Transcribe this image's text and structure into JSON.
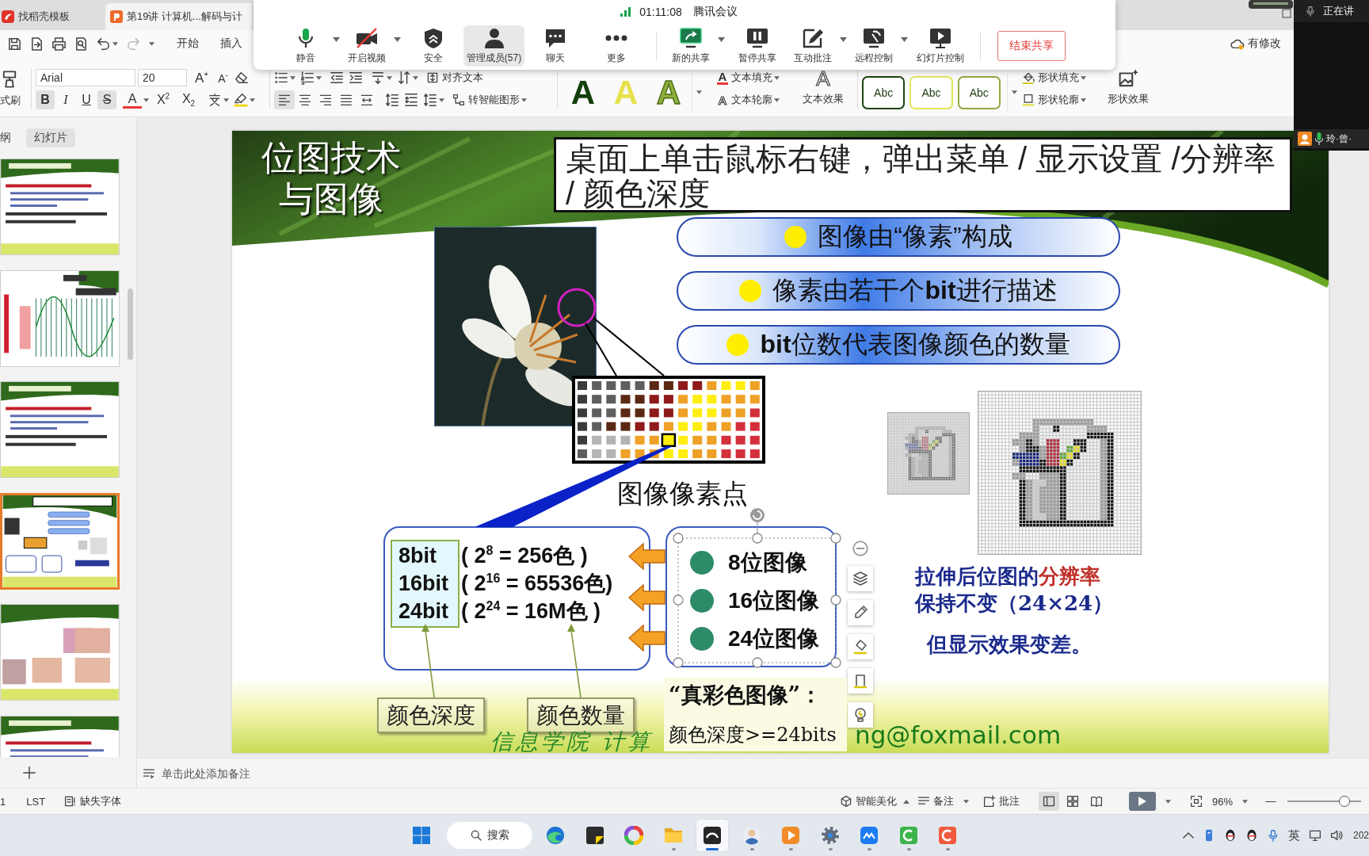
{
  "app_tabs": [
    {
      "kind": "docer",
      "label": "找稻壳模板",
      "selected": false
    },
    {
      "kind": "presentation",
      "label": "第19讲 计算机...解码与计",
      "selected": true
    }
  ],
  "meeting_toolbar": {
    "time": "01:11:08",
    "title": "腾讯会议",
    "buttons": [
      {
        "kind": "mic",
        "label": "静音",
        "dropdown": true,
        "selected": false
      },
      {
        "kind": "camera",
        "label": "开启视频",
        "dropdown": true,
        "selected": false
      },
      {
        "kind": "security",
        "label": "安全",
        "dropdown": false,
        "selected": false
      },
      {
        "kind": "members",
        "label": "管理成员(57)",
        "dropdown": false,
        "selected": true
      },
      {
        "kind": "chat",
        "label": "聊天",
        "dropdown": false,
        "selected": false
      },
      {
        "kind": "more",
        "label": "更多",
        "dropdown": false,
        "selected": false
      },
      {
        "kind": "share",
        "label": "新的共享",
        "dropdown": true,
        "selected": false
      },
      {
        "kind": "pause",
        "label": "暂停共享",
        "dropdown": false,
        "selected": false
      },
      {
        "kind": "annotate",
        "label": "互动批注",
        "dropdown": true,
        "selected": false
      },
      {
        "kind": "remote",
        "label": "远程控制",
        "dropdown": true,
        "selected": false
      },
      {
        "kind": "slideshow",
        "label": "幻灯片控制",
        "dropdown": false,
        "selected": false
      }
    ],
    "end_share": "结束共享"
  },
  "speaker": {
    "status": "正在讲",
    "name": "玲·曾·"
  },
  "quick_access": {
    "redo_disabled": true,
    "menus": [
      "开始",
      "插入"
    ],
    "save_status": "有修改"
  },
  "ribbon": {
    "format_painter": "式刷",
    "font_name": "Arial",
    "font_size": "20",
    "size_buttons": [
      {
        "kind": "grow",
        "label": "A$^{+}$"
      },
      {
        "kind": "shrink",
        "label": "A$^{-}$"
      }
    ],
    "format_buttons": [
      {
        "kind": "bold",
        "label": "B",
        "on": true
      },
      {
        "kind": "italic",
        "label": "I",
        "on": false
      },
      {
        "kind": "underline",
        "label": "U",
        "on": false
      },
      {
        "kind": "strike",
        "label": "S",
        "on": true
      },
      {
        "kind": "color",
        "label": "A",
        "on": false
      },
      {
        "kind": "sup",
        "label": "X$^{2}$",
        "on": false
      },
      {
        "kind": "sub",
        "label": "X$_{2}$",
        "on": false
      }
    ],
    "align_buttons": [
      {
        "kind": "left",
        "selected": true
      },
      {
        "kind": "center",
        "selected": false
      },
      {
        "kind": "right",
        "selected": false
      },
      {
        "kind": "justify",
        "selected": false
      },
      {
        "kind": "distributed",
        "selected": false
      }
    ],
    "align_text": "对齐文本",
    "smart_art": "转智能图形",
    "text_styles": [
      {
        "kind": "fill",
        "label": "A",
        "color": "#143f0c"
      },
      {
        "kind": "fill",
        "label": "A",
        "color": "#e6e24e"
      },
      {
        "kind": "outline",
        "label": "A",
        "color": "#8fb03c"
      }
    ],
    "text_fill": {
      "glyph": "A",
      "label": "文本填充"
    },
    "text_outline": {
      "glyph": "A",
      "label": "文本轮廓"
    },
    "text_effect": {
      "glyph": "A",
      "label": "文本效果"
    },
    "shape_styles": [
      {
        "label": "Abc",
        "color": "#1d4410"
      },
      {
        "label": "Abc",
        "color": "#e2e65a"
      },
      {
        "label": "Abc",
        "color": "#94a842"
      }
    ],
    "shape_fill": "形状填充",
    "shape_outline": "形状轮廓",
    "shape_effect": "形状效果"
  },
  "side_pane": {
    "tabs": [
      {
        "label": "纲",
        "selected": false
      },
      {
        "label": "幻灯片",
        "selected": true
      }
    ],
    "thumbnails": [
      {
        "kind": "text",
        "selected": false
      },
      {
        "kind": "waveform",
        "selected": false
      },
      {
        "kind": "text",
        "selected": false
      },
      {
        "kind": "current",
        "selected": true
      },
      {
        "kind": "photos",
        "selected": false
      },
      {
        "kind": "text",
        "selected": false
      }
    ]
  },
  "slide": {
    "title": "位图技术与图像",
    "instruction": "桌面上单击鼠标右键，弹出菜单 / 显示设置 /分辨率 / 颜色深度",
    "points": [
      "图像由“像素”构成",
      "像素由若干个**bit**进行描述",
      "**bit**位数代表图像颜色的数量"
    ],
    "pixel_label": "图像像素点",
    "bit_rows": [
      {
        "depth": "8bit",
        "count": "( 2$^{8}$ = 256色 )"
      },
      {
        "depth": "16bit",
        "count": "( 2$^{16}$ = 65536色)"
      },
      {
        "depth": "24bit",
        "count": "( 2$^{24}$ = 16M色 )"
      }
    ],
    "image_types": {
      "selected": true,
      "items": [
        "8位图像",
        "16位图像",
        "24位图像"
      ]
    },
    "callouts": [
      "颜色深度",
      "颜色数量"
    ],
    "true_color": {
      "heading": "“真彩色图像”：",
      "rule": "颜色深度>=24bits"
    },
    "footer": {
      "school": "信息学院 计算",
      "email": "ng@foxmail.com"
    },
    "stretch_note": "拉伸后位图的**分辨率**保持不变（24×24）",
    "effect_note": "但显示效果变差。"
  },
  "notes": {
    "placeholder": "单击此处添加备注"
  },
  "status_bar": {
    "slide_number": "1",
    "theme": "LST",
    "missing_fonts": "缺失字体",
    "beautify": "智能美化",
    "notes": "备注",
    "comments": "批注",
    "views": [
      {
        "kind": "normal",
        "selected": true
      },
      {
        "kind": "sorter",
        "selected": false
      },
      {
        "kind": "reading",
        "selected": false
      }
    ],
    "zoom": "96%",
    "zoom_slider": {
      "level": 0.77
    }
  },
  "taskbar": {
    "search": "搜索",
    "apps": [
      {
        "kind": "browser",
        "running": false,
        "selected": false
      },
      {
        "kind": "note",
        "running": false,
        "selected": false
      },
      {
        "kind": "wheel",
        "running": false,
        "selected": false
      },
      {
        "kind": "folder",
        "running": true,
        "selected": false
      },
      {
        "kind": "writer",
        "running": true,
        "selected": true
      },
      {
        "kind": "avatar",
        "running": true,
        "selected": false
      },
      {
        "kind": "player",
        "running": true,
        "selected": false
      },
      {
        "kind": "gear",
        "running": true,
        "selected": false
      },
      {
        "kind": "cloud",
        "running": true,
        "selected": false
      },
      {
        "kind": "green",
        "running": true,
        "selected": false
      },
      {
        "kind": "red",
        "running": true,
        "selected": false
      }
    ],
    "ime": "英",
    "clock": "202"
  }
}
